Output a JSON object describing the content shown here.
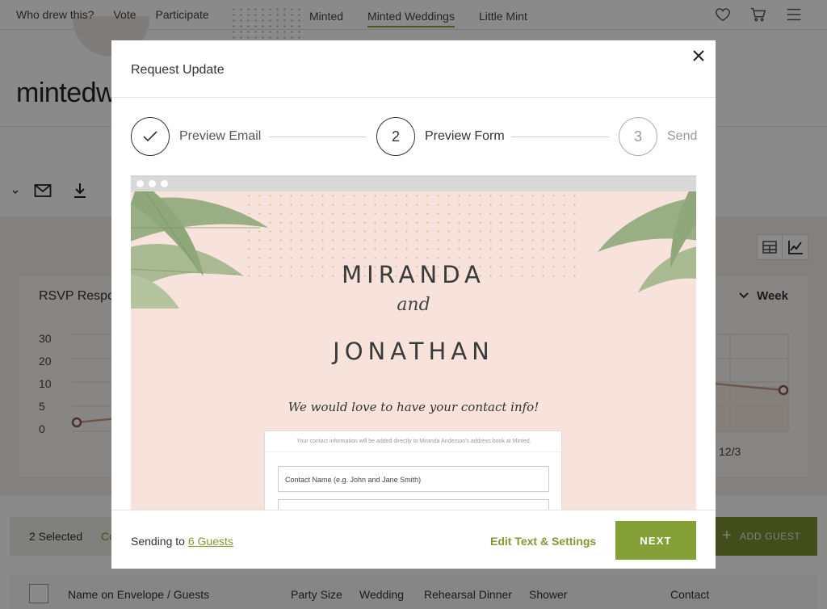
{
  "topnav": {
    "left_links": [
      "Who drew this?",
      "Vote",
      "Participate"
    ],
    "center_links": [
      "Minted",
      "Minted Weddings",
      "Little Mint"
    ],
    "active_center": "Minted Weddings"
  },
  "brand": {
    "text": "mintedw"
  },
  "chart": {
    "title": "RSVP Respor",
    "period": "Week",
    "y_ticks": [
      "30",
      "20",
      "10",
      "5",
      "0"
    ],
    "x_tick_visible": "12/3"
  },
  "chart_data": {
    "type": "line",
    "title": "RSVP Respor",
    "yticks": [
      0,
      5,
      10,
      20,
      30
    ],
    "x": [
      "12/3"
    ],
    "series": [
      {
        "values": [
          2,
          9
        ]
      }
    ]
  },
  "selection": {
    "count_label": "2 Selected",
    "fragment": "Co"
  },
  "add_guest": {
    "label": "ADD GUEST"
  },
  "table": {
    "headers": [
      "Name on Envelope / Guests",
      "Party Size",
      "Wedding",
      "Rehearsal Dinner",
      "Shower",
      "Contact"
    ]
  },
  "modal": {
    "title": "Request Update",
    "steps": [
      {
        "number": "",
        "label": "Preview Email",
        "state": "complete"
      },
      {
        "number": "2",
        "label": "Preview Form",
        "state": "current"
      },
      {
        "number": "3",
        "label": "Send",
        "state": "upcoming"
      }
    ],
    "preview": {
      "name_one": "MIRANDA",
      "joiner": "and",
      "name_two": "JONATHAN",
      "tagline": "We would love to have your contact info!",
      "form_note": "Your contact information will be added directly to Miranda Anderson's address book at Minted.",
      "contact_placeholder": "Contact Name (e.g. John and Jane Smith)",
      "second_placeholder": ""
    },
    "footer": {
      "sending_prefix": "Sending to ",
      "guests_link": "6 Guests",
      "edit_label": "Edit Text & Settings",
      "next_label": "NEXT"
    }
  },
  "colors": {
    "accent": "#84a036",
    "blush": "#f8e2dc",
    "overlay": "rgba(0,0,0,0.46)"
  }
}
